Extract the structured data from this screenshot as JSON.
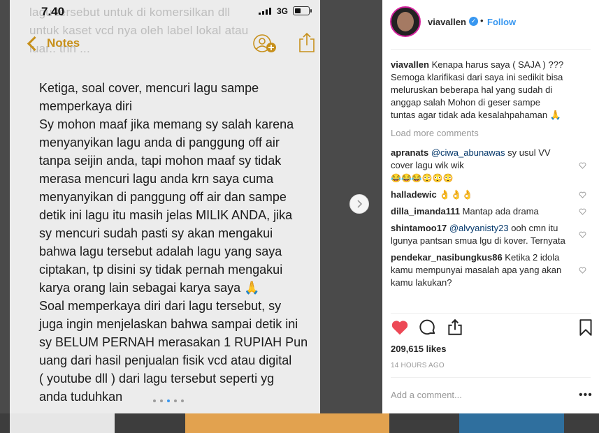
{
  "image": {
    "status_time": "7.40",
    "network": "3G",
    "ghost_lines": [
      "lagu tersebut untuk di komersilkan dll",
      "untuk kaset vcd nya oleh label lokal atau",
      "luar.. thn ..."
    ],
    "back_label": "Notes",
    "note_lines": [
      "Ketiga, soal cover, mencuri lagu sampe",
      "memperkaya diri",
      "Sy mohon maaf jika memang sy salah karena",
      "menyanyikan lagu anda di panggung off air",
      "tanpa seijin anda, tapi mohon maaf sy tidak",
      "merasa mencuri lagu anda krn saya cuma",
      "menyanyikan di panggung off air dan sampe",
      "detik ini lagu itu masih jelas MILIK ANDA, jika",
      "sy mencuri sudah pasti sy akan mengakui",
      "bahwa lagu tersebut adalah lagu yang saya",
      "ciptakan, tp disini sy tidak pernah mengakui",
      "karya orang lain sebagai karya saya 🙏",
      "Soal memperkaya diri dari lagu tersebut, sy",
      "juga ingin menjelaskan bahwa sampai detik ini",
      "sy BELUM PERNAH merasakan 1 RUPIAH Pun",
      "uang dari hasil penjualan fisik vcd atau digital",
      "( youtube dll ) dari lagu tersebut seperti yg",
      "anda tuduhkan"
    ]
  },
  "header": {
    "username": "viavallen",
    "separator": "•",
    "follow": "Follow"
  },
  "caption": {
    "username": "viavallen",
    "text": "Kenapa harus saya ( SAJA ) ??? Semoga klarifikasi dari saya ini sedikit bisa meluruskan beberapa hal yang sudah di anggap salah Mohon di geser sampe tuntas agar tidak ada kesalahpahaman 🙏"
  },
  "load_more": "Load more comments",
  "comments": [
    {
      "user": "apranats",
      "mention": "@ciwa_abunawas",
      "text": "sy usul VV cover lagu wik wik",
      "emojis": "😂😂😂😳😳😳"
    },
    {
      "user": "halladewic",
      "mention": "",
      "text": "👌👌👌",
      "emojis": ""
    },
    {
      "user": "dilla_imanda111",
      "mention": "",
      "text": "Mantap ada drama",
      "emojis": ""
    },
    {
      "user": "shintamoo17",
      "mention": "@alvyanisty23",
      "text": "ooh cmn itu lgunya pantsan smua lgu di kover. Ternyata",
      "emojis": ""
    },
    {
      "user": "pendekar_nasibungkus86",
      "mention": "",
      "text": "Ketika 2 idola kamu mempunyai masalah apa yang akan kamu lakukan?",
      "emojis": ""
    }
  ],
  "likes": "209,615 likes",
  "time_ago": "14 HOURS AGO",
  "add_comment_placeholder": "Add a comment...",
  "more_label": "•••",
  "icons": {
    "heart": "heart-icon",
    "comment": "comment-icon",
    "share": "share-icon",
    "bookmark": "bookmark-icon"
  },
  "colors": {
    "like_red": "#ed4956",
    "link_blue": "#3897f0",
    "notes_gold": "#c7901b"
  }
}
